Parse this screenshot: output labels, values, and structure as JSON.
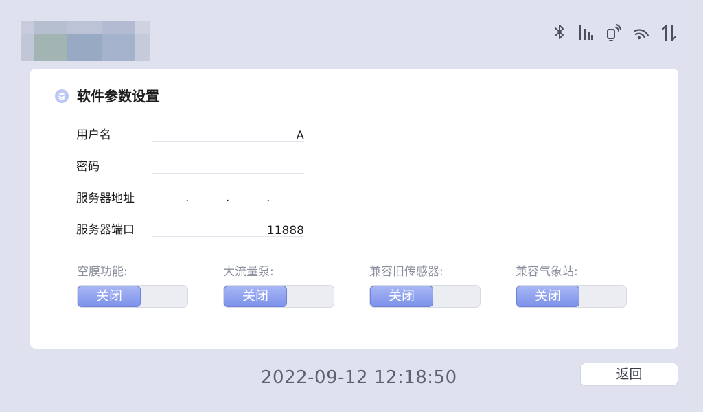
{
  "colors": {
    "background": "#dfe2ee",
    "card": "#ffffff",
    "toggle_knob": "#8a9cef",
    "toggle_track": "#ebedf2",
    "label_muted": "#8a8f9c"
  },
  "status_icons": [
    "bluetooth-icon",
    "signal-bars-icon",
    "device-signal-icon",
    "wifi-signal-icon",
    "data-transfer-icon"
  ],
  "header": {
    "title": "软件参数设置",
    "title_icon": "settings-badge-icon"
  },
  "fields": [
    {
      "label": "用户名",
      "value": "A"
    },
    {
      "label": "密码",
      "value": ""
    },
    {
      "label": "服务器地址",
      "value": ". . ."
    },
    {
      "label": "服务器端口",
      "value": "11888"
    }
  ],
  "toggles": [
    {
      "label": "空膜功能:",
      "state": "关闭"
    },
    {
      "label": "大流量泵:",
      "state": "关闭"
    },
    {
      "label": "兼容旧传感器:",
      "state": "关闭"
    },
    {
      "label": "兼容气象站:",
      "state": "关闭"
    }
  ],
  "footer": {
    "datetime": "2022-09-12 12:18:50",
    "back_label": "返回"
  }
}
